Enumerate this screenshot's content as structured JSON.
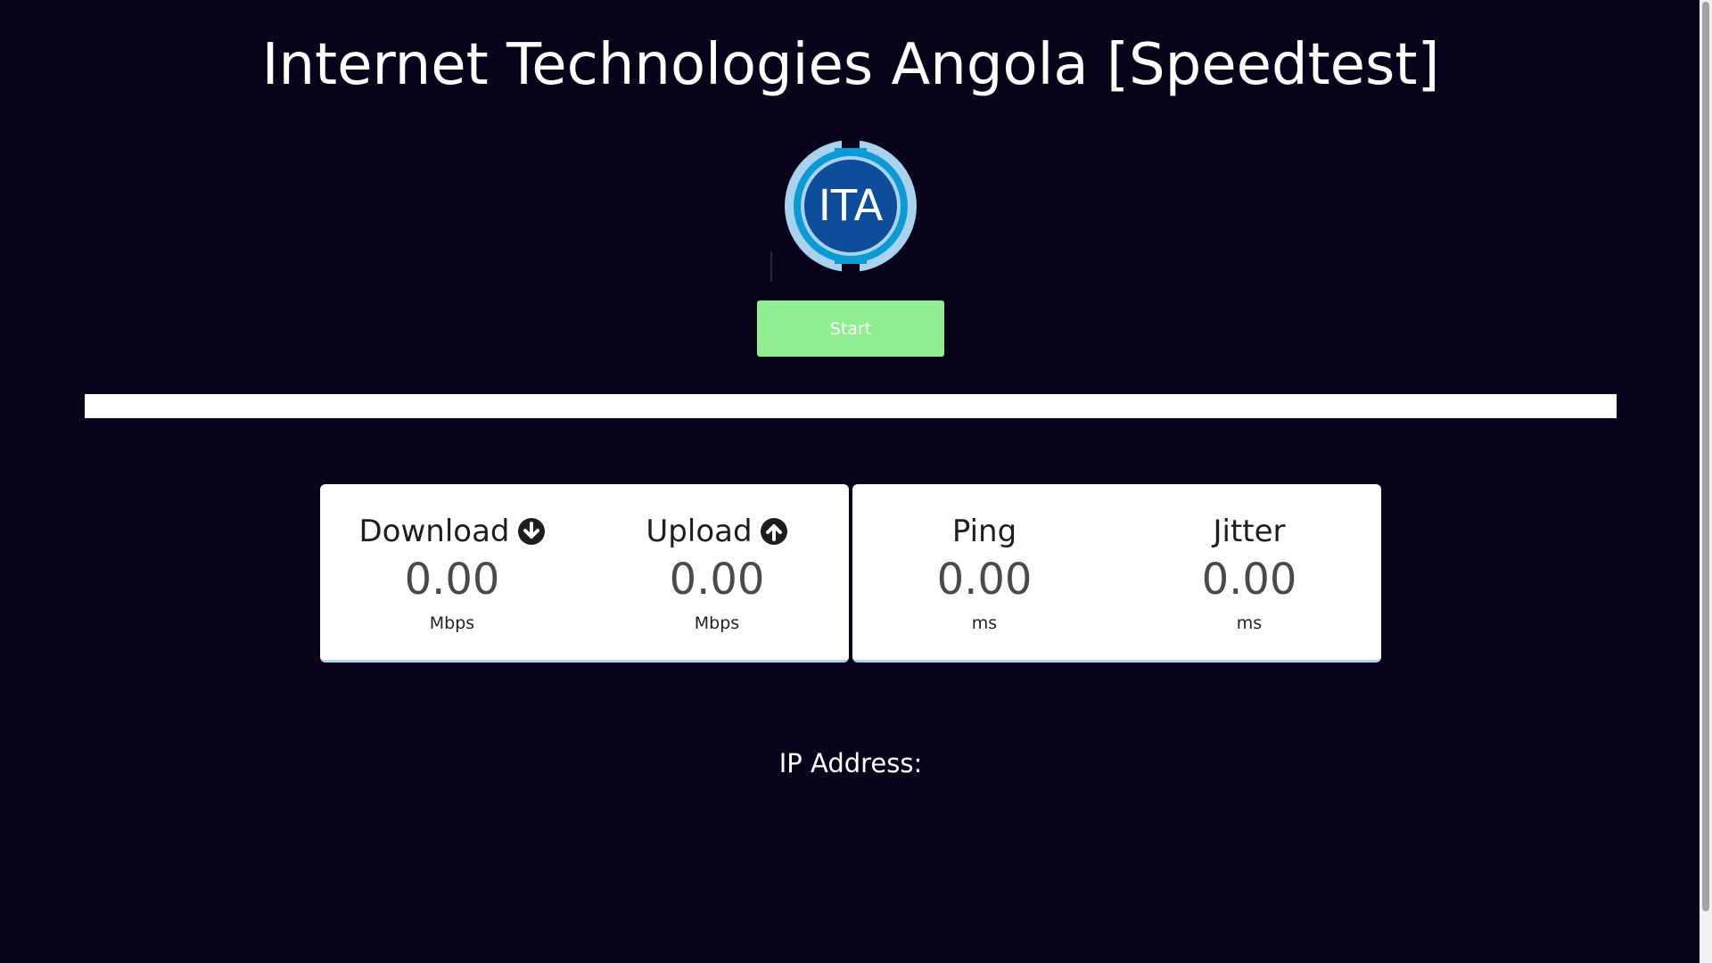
{
  "page": {
    "title": "Internet Technologies Angola [Speedtest]",
    "background_color": "#08031a"
  },
  "logo": {
    "text": "ITA",
    "icon": "ita-logo-icon",
    "colors": {
      "outer_ring": "#a9d2ef",
      "mid_ring": "#0b9ad6",
      "inner_circle": "#0e4d9b"
    }
  },
  "start_button": {
    "label": "Start",
    "color": "#90ee90"
  },
  "progress": {
    "value": 0
  },
  "metrics": {
    "download": {
      "label": "Download",
      "value": "0.00",
      "unit": "Mbps",
      "icon": "arrow-down-circle-icon"
    },
    "upload": {
      "label": "Upload",
      "value": "0.00",
      "unit": "Mbps",
      "icon": "arrow-up-circle-icon"
    },
    "ping": {
      "label": "Ping",
      "value": "0.00",
      "unit": "ms"
    },
    "jitter": {
      "label": "Jitter",
      "value": "0.00",
      "unit": "ms"
    }
  },
  "ip_address": {
    "label": "IP Address:"
  }
}
